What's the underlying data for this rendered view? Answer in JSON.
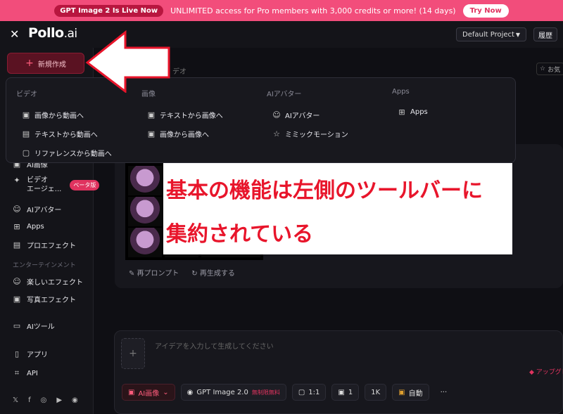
{
  "banner": {
    "pill": "GPT Image 2 Is Live Now",
    "message": "UNLIMITED access for Pro members with 3,000 credits or more! (14 days)",
    "button": "Try Now"
  },
  "header": {
    "logo_main": "Pollo",
    "logo_suffix": ".ai",
    "project": "Default Project",
    "history": "履歴"
  },
  "new_button": "新規作成",
  "main": {
    "crumb": "デオ",
    "fav": "お気"
  },
  "menu": {
    "video": {
      "head": "ビデオ",
      "items": [
        "画像から動画へ",
        "テキストから動画へ",
        "リファレンスから動画へ"
      ]
    },
    "image": {
      "head": "画像",
      "items": [
        "テキストから画像へ",
        "画像から画像へ"
      ]
    },
    "avatar": {
      "head": "AIアバター",
      "items": [
        "AIアバター",
        "ミミックモーション"
      ]
    },
    "apps": {
      "head": "Apps",
      "items": [
        "Apps"
      ]
    }
  },
  "sidebar": {
    "partial": "AI画像",
    "video_agent": "ビデオ\nエージェ...",
    "beta": "ベータ版",
    "items": [
      "AIアバター",
      "Apps",
      "プロエフェクト"
    ],
    "section_ent": "エンターテインメント",
    "ent_items": [
      "楽しいエフェクト",
      "写真エフェクト"
    ],
    "tools": "AIツール",
    "app": "アプリ",
    "api": "API"
  },
  "annotation": {
    "line1": "基本の機能は左側のツールバーに",
    "line2": "集約されている"
  },
  "card_actions": [
    "再プロンプト",
    "再生成する"
  ],
  "composer": {
    "placeholder": "アイデアを入力して生成してください",
    "upgrade": "アップグレ",
    "mode": "AI画像",
    "model": "GPT Image 2.0",
    "model_badge": "無制限無料",
    "ratio": "1:1",
    "count": "1",
    "resolution": "1K",
    "style": "自動",
    "more": "···"
  },
  "colors": {
    "accent": "#e0335f",
    "banner": "#f24d7b",
    "annotation": "#e8152b"
  }
}
